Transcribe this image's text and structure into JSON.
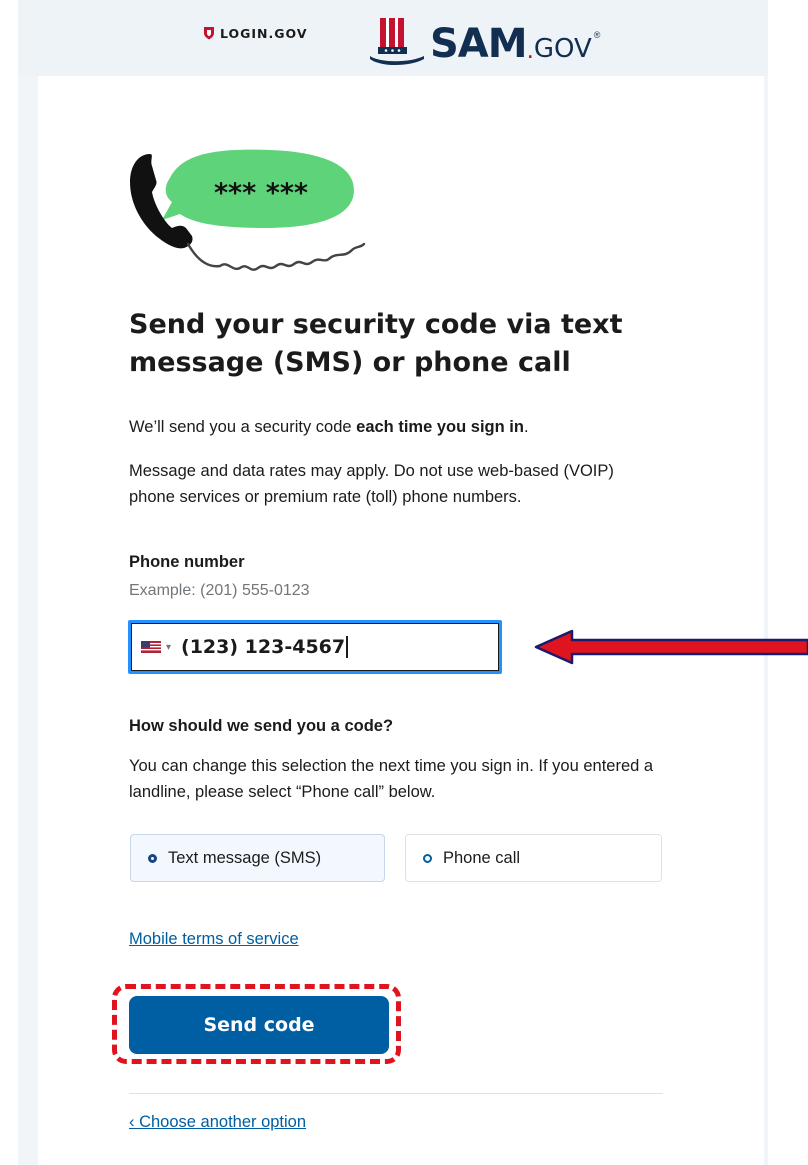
{
  "header": {
    "login_brand": "LOGIN.GOV",
    "sam_brand_main": "SAM",
    "sam_brand_dot": ".",
    "sam_brand_suffix": "GOV",
    "sam_brand_mark": "®"
  },
  "hero": {
    "bubble_text": "*** ***"
  },
  "page": {
    "title": "Send your security code via text message (SMS) or phone call",
    "intro_prefix": "We’ll send you a security code ",
    "intro_bold": "each time you sign in",
    "intro_suffix": ".",
    "rates_notice": "Message and data rates may apply. Do not use web-based (VOIP) phone services or premium rate (toll) phone numbers."
  },
  "phone": {
    "label": "Phone number",
    "example": "Example: (201) 555-0123",
    "country": "United States",
    "value": "(123) 123-4567"
  },
  "delivery": {
    "question": "How should we send you a code?",
    "help": "You can change this selection the next time you sign in. If you entered a landline, please select “Phone call” below.",
    "options": [
      {
        "label": "Text message (SMS)",
        "selected": true
      },
      {
        "label": "Phone call",
        "selected": false
      }
    ]
  },
  "links": {
    "mobile_terms": "Mobile terms of service",
    "choose_another": "‹ Choose another option"
  },
  "actions": {
    "send_code": "Send code"
  },
  "colors": {
    "primary": "#005ea2",
    "focus": "#2491ff",
    "annotation_red": "#e0141e",
    "sam_navy": "#122e51",
    "bubble_green": "#5fd37a"
  }
}
